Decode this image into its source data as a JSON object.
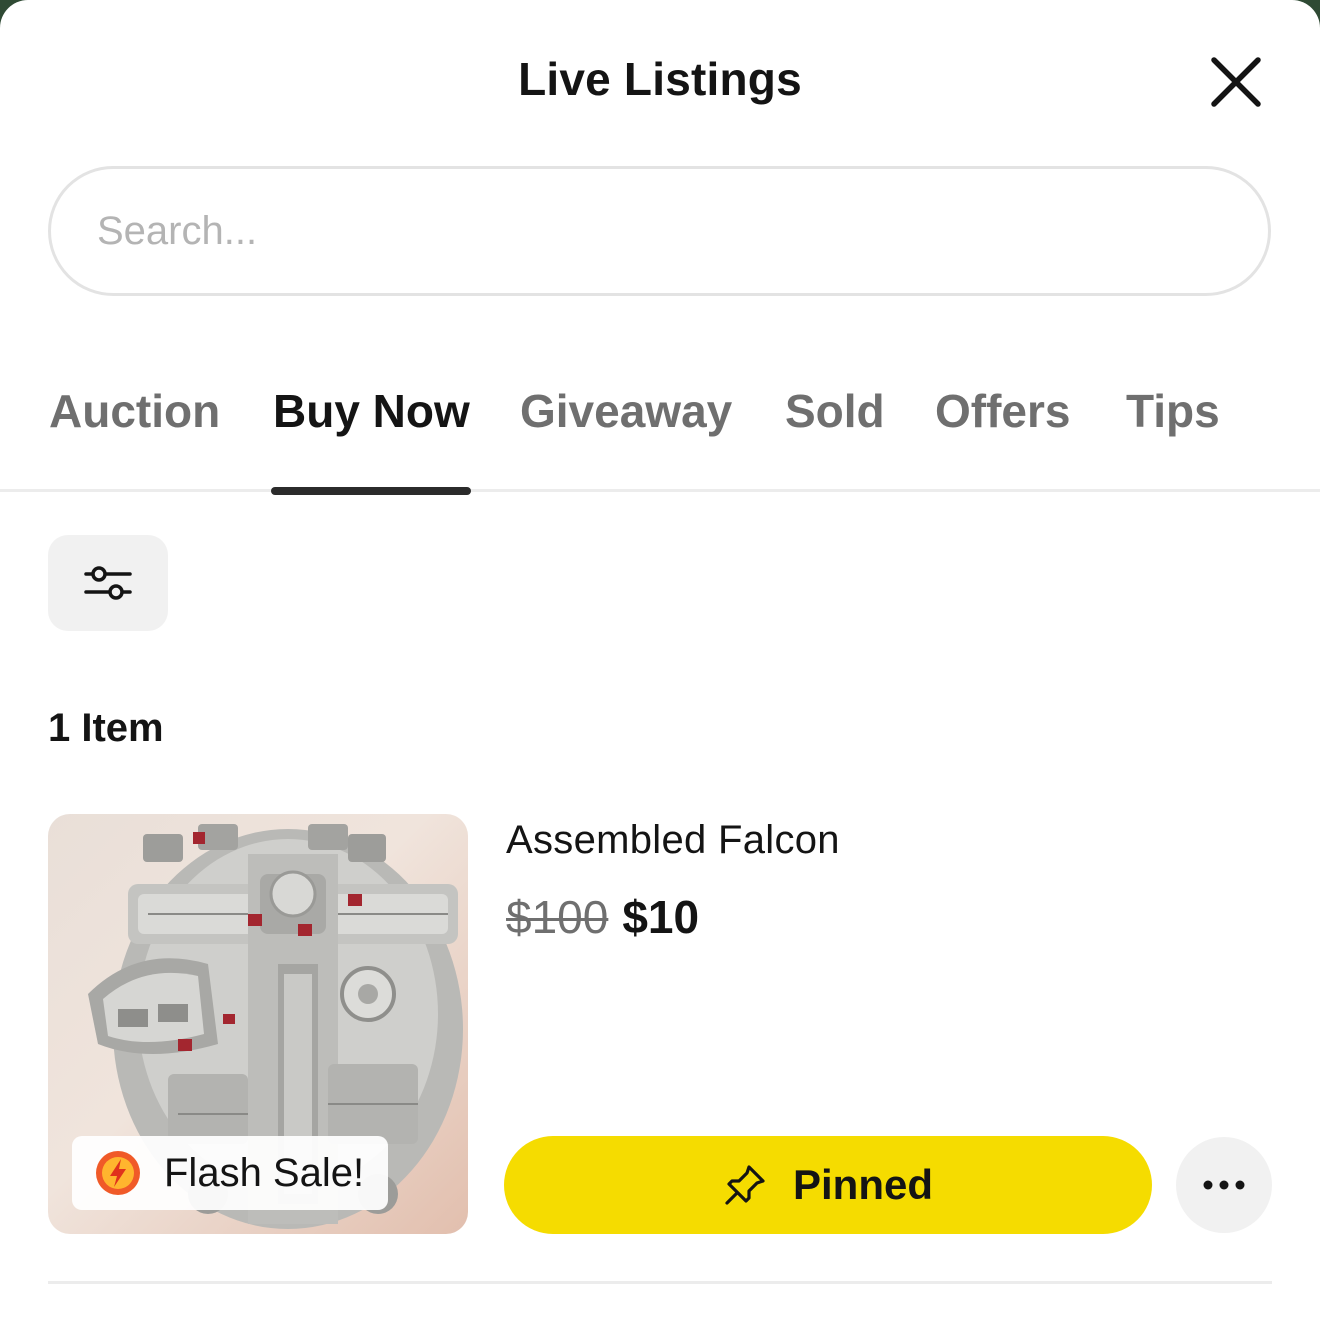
{
  "header": {
    "title": "Live Listings",
    "close_icon": "close-icon"
  },
  "search": {
    "placeholder": "Search...",
    "value": ""
  },
  "tabs": [
    {
      "label": "Auction",
      "active": false
    },
    {
      "label": "Buy Now",
      "active": true
    },
    {
      "label": "Giveaway",
      "active": false
    },
    {
      "label": "Sold",
      "active": false
    },
    {
      "label": "Offers",
      "active": false
    },
    {
      "label": "Tips",
      "active": false
    }
  ],
  "filter": {
    "icon": "sliders-icon"
  },
  "list": {
    "count_label": "1 Item",
    "items": [
      {
        "title": "Assembled Falcon",
        "original_price": "$100",
        "price": "$10",
        "badge": "Flash Sale!",
        "badge_icon": "lightning-icon",
        "action_label": "Pinned",
        "action_icon": "pin-icon",
        "more_icon": "more-icon"
      }
    ]
  },
  "colors": {
    "accent": "#F5DC00",
    "text_primary": "#141414",
    "text_secondary": "#6F6F6F",
    "badge_icon": "#F05A28"
  }
}
